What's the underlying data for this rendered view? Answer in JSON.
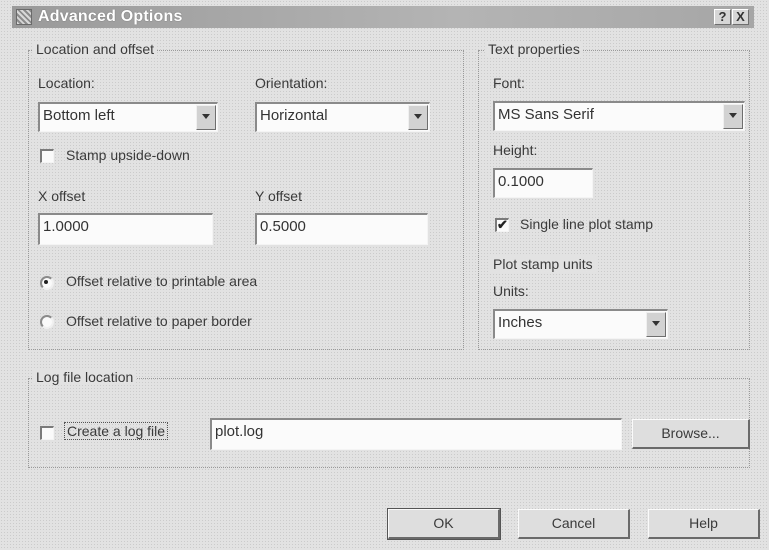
{
  "dialog": {
    "title": "Advanced Options",
    "help_glyph": "?",
    "close_glyph": "X"
  },
  "location_offset": {
    "group_label": "Location and offset",
    "location_label": "Location:",
    "location_value": "Bottom left",
    "orientation_label": "Orientation:",
    "orientation_value": "Horizontal",
    "stamp_upside_down_label": "Stamp upside-down",
    "stamp_upside_down_checked": false,
    "x_offset_label": "X offset",
    "x_offset_value": "1.0000",
    "y_offset_label": "Y offset",
    "y_offset_value": "0.5000",
    "radio_printable_label": "Offset relative to printable area",
    "radio_paper_label": "Offset relative to paper border",
    "selected_offset_mode": "printable area"
  },
  "text_properties": {
    "group_label": "Text properties",
    "font_label": "Font:",
    "font_value": "MS Sans Serif",
    "height_label": "Height:",
    "height_value": "0.1000",
    "single_line_label": "Single line plot stamp",
    "single_line_checked": true,
    "check_glyph": "✔"
  },
  "plot_stamp_units": {
    "group_label": "Plot stamp units",
    "units_label": "Units:",
    "units_value": "Inches"
  },
  "log_file": {
    "group_label": "Log file location",
    "create_log_label": "Create a log file",
    "create_log_checked": false,
    "path_value": "plot.log",
    "browse_label": "Browse..."
  },
  "buttons": {
    "ok_label": "OK",
    "cancel_label": "Cancel",
    "help_label": "Help"
  }
}
